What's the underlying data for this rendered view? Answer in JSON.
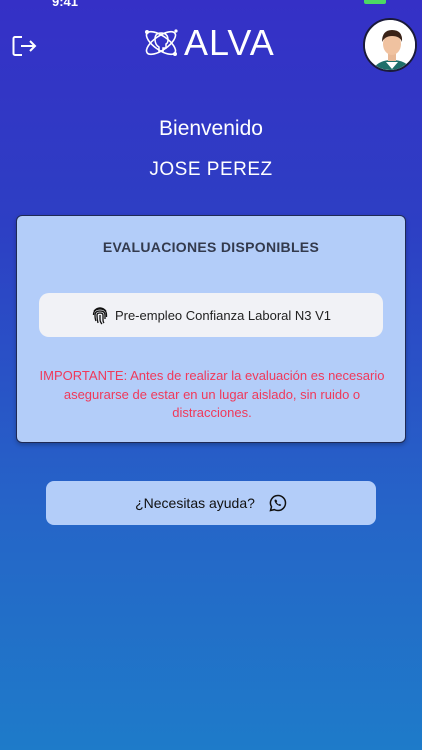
{
  "status_bar": {
    "time": "9:41"
  },
  "header": {
    "logo_text": "ALVA",
    "icons": {
      "logout": "logout-icon",
      "logo": "brain-atom-icon",
      "avatar": "user-avatar"
    }
  },
  "welcome": {
    "greeting": "Bienvenido",
    "user_name": "JOSE PEREZ"
  },
  "evaluations": {
    "title": "EVALUACIONES DISPONIBLES",
    "items": [
      {
        "label": "Pre-empleo Confianza Laboral N3 V1",
        "icon": "fingerprint-icon"
      }
    ],
    "notice": "IMPORTANTE: Antes de realizar la evaluación es necesario asegurarse de estar en un lugar aislado, sin ruido o distracciones."
  },
  "help": {
    "label": "¿Necesitas ayuda?",
    "icon": "whatsapp-icon"
  },
  "colors": {
    "bg_top": "#3530c6",
    "bg_bottom": "#1e7bc9",
    "card_bg": "#b3cdf9",
    "notice_text": "#f0395a",
    "button_bg": "#f1f2f6"
  }
}
